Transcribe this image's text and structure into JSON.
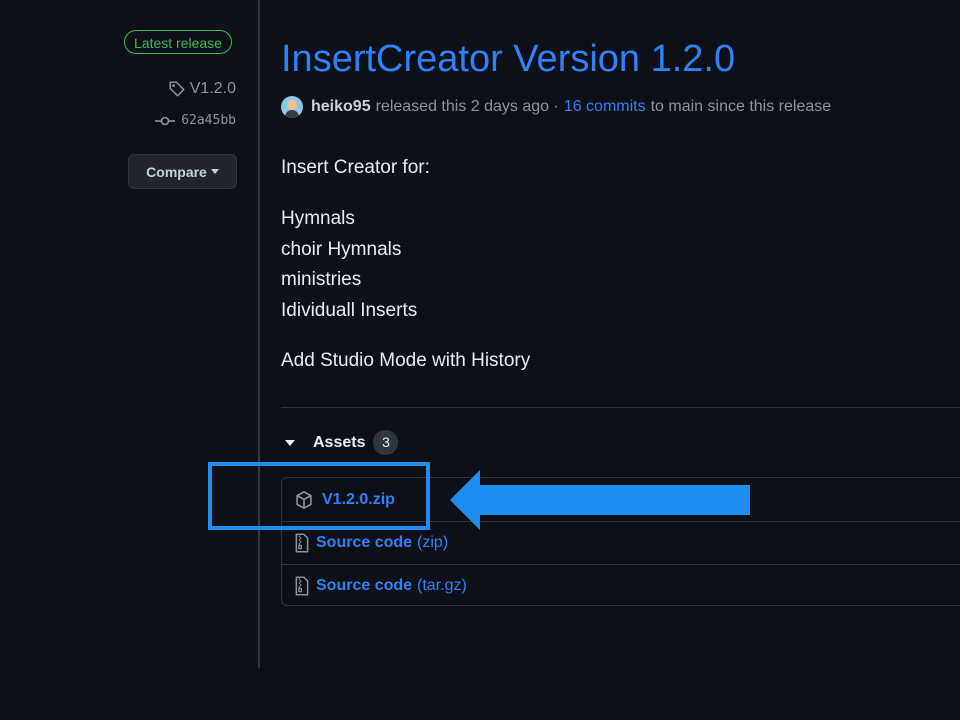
{
  "sidebar": {
    "latest_badge": "Latest release",
    "tag": "V1.2.0",
    "commit": "62a45bb",
    "compare_label": "Compare"
  },
  "release": {
    "title": "InsertCreator Version 1.2.0",
    "author": "heiko95",
    "released_text": "released this 2 days ago ·",
    "commits_link": "16 commits",
    "commits_suffix": "to main since this release",
    "body": {
      "intro": "Insert Creator for:",
      "items": [
        "Hymnals",
        "choir Hymnals",
        "ministries",
        "Idividuall Inserts"
      ],
      "note": "Add Studio Mode with History"
    }
  },
  "assets": {
    "heading": "Assets",
    "count": "3",
    "files": [
      {
        "name": "V1.2.0.zip",
        "suffix": "",
        "icon": "package-icon"
      },
      {
        "name": "Source code",
        "suffix": "(zip)",
        "icon": "file-zip-icon"
      },
      {
        "name": "Source code",
        "suffix": "(tar.gz)",
        "icon": "file-zip-icon"
      }
    ]
  },
  "colors": {
    "background": "#0d1117",
    "link": "#2f81f7",
    "badge_green": "#3fb950",
    "annotation_blue": "#1f8ef1"
  }
}
